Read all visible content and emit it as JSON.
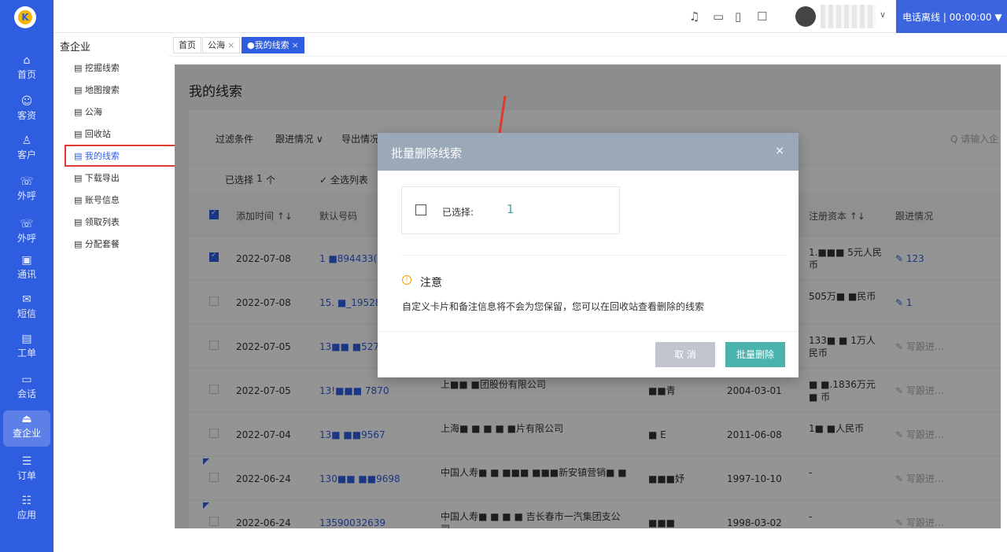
{
  "nav": {
    "items": [
      "首页",
      "客资",
      "客户",
      "外呼",
      "外呼",
      "通讯",
      "短信",
      "工单",
      "会话",
      "查企业",
      "订单",
      "应用"
    ],
    "icons": [
      "⌂",
      "☺",
      "♙",
      "☏",
      "☏",
      "▣",
      "✉",
      "▤",
      "▭",
      "⏏",
      "☰",
      "☷"
    ],
    "active": "查企业"
  },
  "topbar": {
    "phone_status": "电话离线 |  00:00:00 ▼"
  },
  "subnav": {
    "title": "查企业",
    "items": [
      "挖掘线索",
      "地图搜索",
      "公海",
      "回收站",
      "我的线索",
      "下载导出",
      "账号信息",
      "领取列表",
      "分配套餐"
    ],
    "active": "我的线索"
  },
  "tabs": [
    {
      "label": "首页"
    },
    {
      "label": "公海",
      "close": "×"
    },
    {
      "label": "●我的线索",
      "close": "×"
    }
  ],
  "page": {
    "title": "我的线索"
  },
  "filters": [
    "过滤条件",
    "跟进情况 ∨",
    "导出情况"
  ],
  "search_placeholder": "Q 请输入企",
  "selection": {
    "prefix": "已选择",
    "count": "1",
    "suffix": "个",
    "select_all": "✓ 全选列表"
  },
  "columns": [
    "添加时间 ↑↓",
    "默认号码",
    "注册资本 ↑↓",
    "跟进情况"
  ],
  "rows": [
    {
      "date": "2022-07-08",
      "phone": "1  ■894433(",
      "company": "",
      "person": "",
      "found": "",
      "capital": "1.■■■ 5元人民币",
      "follow": "123",
      "checked": true
    },
    {
      "date": "2022-07-08",
      "phone": "15. ■_19528",
      "company": "",
      "person": "",
      "found": "",
      "capital": "505万■ ■民币",
      "follow": "1",
      "checked": false
    },
    {
      "date": "2022-07-05",
      "phone": "13■■ ■5271",
      "company": "",
      "person": "",
      "found": "",
      "capital": "133■ ■ 1万人民币",
      "follow": "写跟进...",
      "checked": false
    },
    {
      "date": "2022-07-05",
      "phone": "13!■■■ 7870",
      "company": "上■■ ■团股份有限公司",
      "person": "■■青",
      "found": "2004-03-01",
      "capital": "■ ■.1836万元■ 币",
      "follow": "写跟进...",
      "checked": false
    },
    {
      "date": "2022-07-04",
      "phone": "13■ ■■9567",
      "company": "上海■ ■ ■ ■ ■片有限公司",
      "person": "■ E",
      "found": "2011-06-08",
      "capital": "1■ ■人民币",
      "follow": "写跟进...",
      "checked": false
    },
    {
      "date": "2022-06-24",
      "phone": "130■■ ■■9698",
      "company": "中国人寿■ ■ ■■■ ■■■新安镇营销■ ■",
      "person": "■■■妤",
      "found": "1997-10-10",
      "capital": "-",
      "follow": "写跟进...",
      "checked": false
    },
    {
      "date": "2022-06-24",
      "phone": "13590032639",
      "company": "中国人寿■ ■ ■ ■ 吉长春市一汽集团支公司",
      "person": "■■■",
      "found": "1998-03-02",
      "capital": "-",
      "follow": "写跟进...",
      "checked": false
    }
  ],
  "dialog": {
    "title": "批量删除线索",
    "close": "×",
    "selected_label": "已选择:",
    "selected_count": "1",
    "notice_title": "注意",
    "notice_text": "自定义卡片和备注信息将不会为您保留，您可以在回收站查看删除的线索",
    "cancel": "取 消",
    "confirm": "批量删除"
  }
}
